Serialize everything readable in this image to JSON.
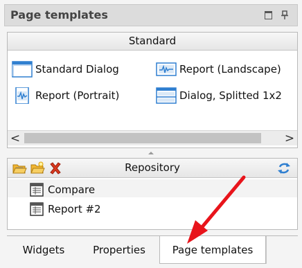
{
  "panel": {
    "title": "Page templates",
    "title_icons": [
      "restore-icon",
      "pin-icon"
    ]
  },
  "templates": {
    "group": "Standard",
    "items": [
      {
        "label": "Standard Dialog",
        "icon": "dialog-template-icon"
      },
      {
        "label": "Report (Landscape)",
        "icon": "report-landscape-icon"
      },
      {
        "label": "Report (Portrait)",
        "icon": "report-portrait-icon"
      },
      {
        "label": "Dialog, Splitted 1x2",
        "icon": "dialog-split-icon"
      }
    ],
    "scroll_left": "<",
    "scroll_right": ">"
  },
  "repository": {
    "title": "Repository",
    "toolbar_icons": [
      "open-folder-icon",
      "new-folder-icon",
      "delete-icon",
      "refresh-icon"
    ],
    "items": [
      {
        "label": "Compare",
        "icon": "page-icon"
      },
      {
        "label": "Report #2",
        "icon": "page-icon"
      }
    ]
  },
  "tabs": {
    "items": [
      "Widgets",
      "Properties",
      "Page templates"
    ],
    "active_index": 2
  },
  "colors": {
    "annotation_arrow": "#e8141b",
    "icon_blue": "#2f7fd0",
    "delete_red": "#d93a1f",
    "folder_yellow": "#f2b632"
  }
}
